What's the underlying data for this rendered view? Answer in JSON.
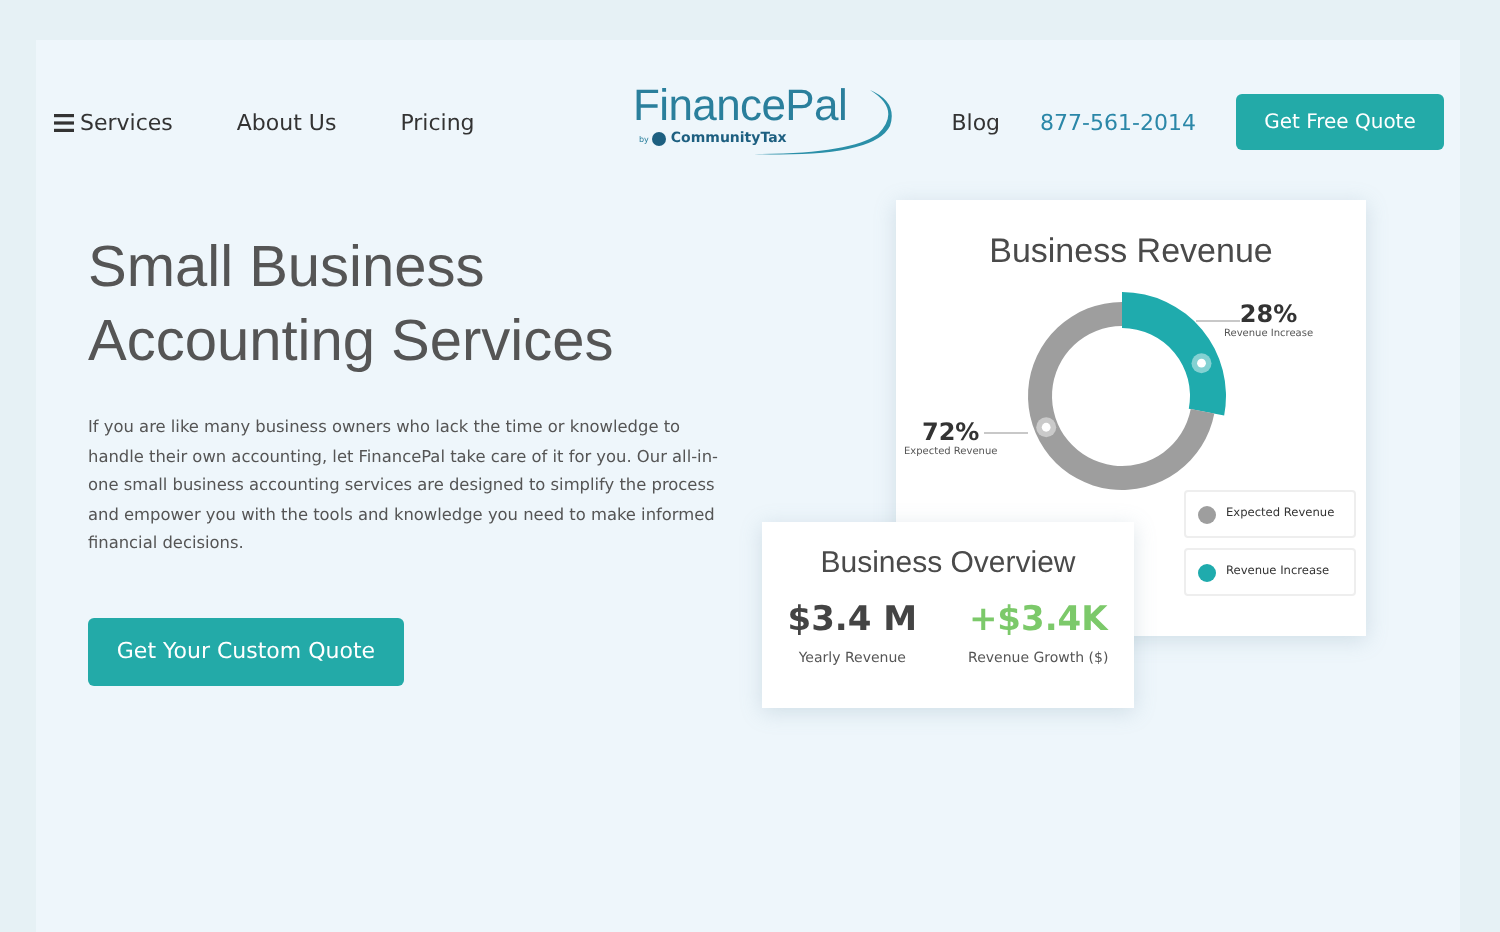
{
  "nav": {
    "left": [
      {
        "label": "Services",
        "kind": "menu"
      },
      {
        "label": "About Us",
        "kind": "link"
      },
      {
        "label": "Pricing",
        "kind": "link"
      }
    ],
    "logo": {
      "name": "FinancePal",
      "by": "by",
      "company": "CommunityTax"
    },
    "right": [
      {
        "label": "Blog",
        "kind": "link"
      },
      {
        "label": "877-561-2014",
        "kind": "phone"
      }
    ],
    "cta": "Get Free Quote"
  },
  "hero": {
    "title": "Small Business Accounting Services",
    "text": "If you are like many business owners who lack the time or knowledge to handle their own accounting, let FinancePal take care of it for you. Our all-in-one small business accounting services are designed to simplify the process and empower you with the tools and knowledge you need to make informed financial decisions.",
    "button": "Get Your Custom Quote"
  },
  "revenue_card": {
    "title": "Business Revenue",
    "chart_data": {
      "type": "donut",
      "categories": [
        "Expected Revenue",
        "Revenue Increase"
      ],
      "values": [
        72,
        28
      ],
      "value_labels": [
        "72%",
        "28%"
      ]
    },
    "legend": [
      {
        "label": "Expected Revenue",
        "color": "#9e9e9e"
      },
      {
        "label": "Revenue Increase",
        "color": "#1fabad"
      }
    ]
  },
  "overview_card": {
    "title": "Business Overview",
    "stats": [
      {
        "value": "$3.4 M",
        "label": "Yearly Revenue",
        "kind": "plain"
      },
      {
        "value": "+$3.4K",
        "label": "Revenue Growth ($)",
        "kind": "growth"
      }
    ]
  }
}
